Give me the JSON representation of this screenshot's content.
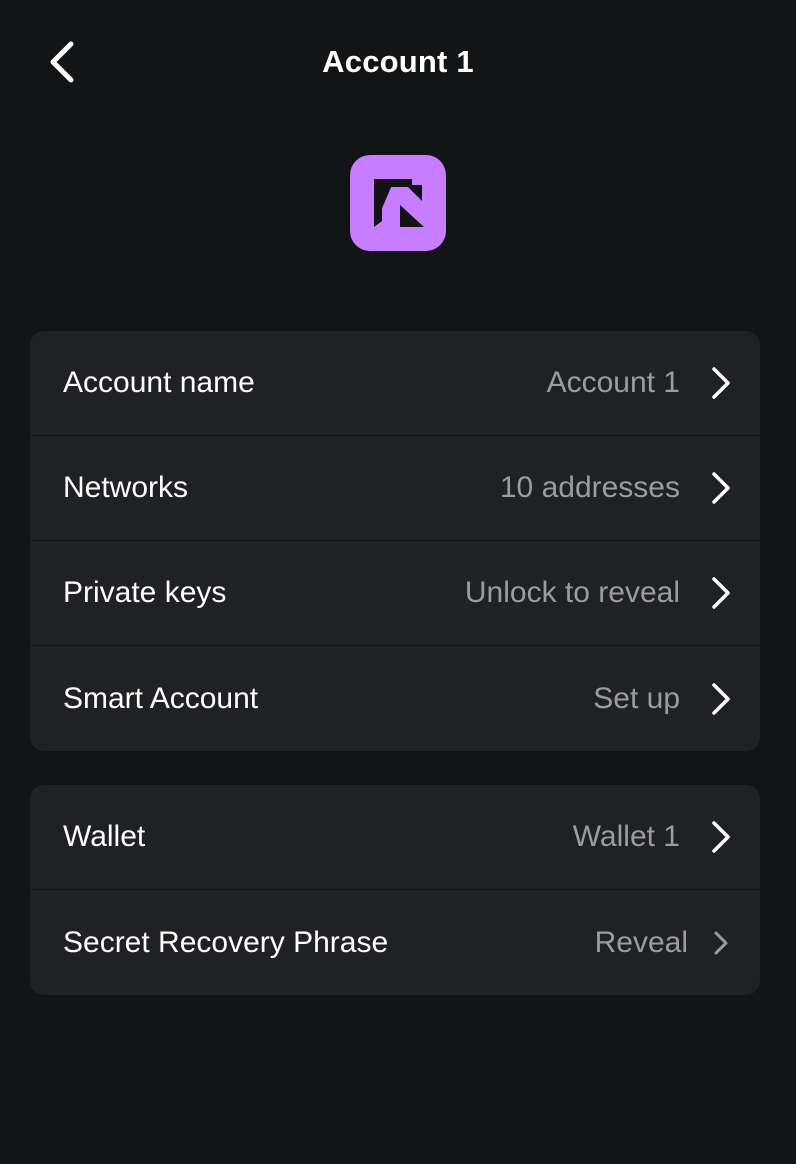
{
  "header": {
    "title": "Account 1",
    "back_icon": "chevron-left-icon"
  },
  "avatar": {
    "icon": "account-avatar-logo",
    "background": "#C77DFF"
  },
  "account_section": {
    "rows": [
      {
        "label": "Account name",
        "value": "Account 1"
      },
      {
        "label": "Networks",
        "value": "10 addresses"
      },
      {
        "label": "Private keys",
        "value": "Unlock to reveal"
      },
      {
        "label": "Smart Account",
        "value": "Set up"
      }
    ]
  },
  "wallet_section": {
    "rows": [
      {
        "label": "Wallet",
        "value": "Wallet 1"
      },
      {
        "label": "Secret Recovery Phrase",
        "value": "Reveal"
      }
    ]
  },
  "colors": {
    "background": "#131416",
    "card": "#202124",
    "secondary_text": "#9B9CA1",
    "accent": "#C77DFF"
  }
}
